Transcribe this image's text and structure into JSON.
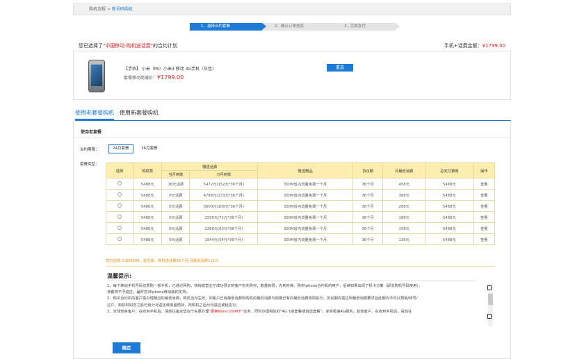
{
  "breadcrumb": {
    "root": "购机流程",
    "sep": ">",
    "current": "新号码购机"
  },
  "steps": [
    "1、选择合约套餐",
    "2、确认订单信息",
    "3、完成支付"
  ],
  "plan_line": {
    "prefix": "您已选择了",
    "quote_open": "\"",
    "plan_name": "中国移动-购机送话费",
    "quote_close": "\"",
    "suffix": "的合约计划"
  },
  "total": {
    "label": "手机+话费金额：",
    "amount": "¥1799.00"
  },
  "product": {
    "name": "【手机】 小米（MI）小米3 移动 3G手机（灰色）",
    "price_label": "套餐移动商城价：",
    "price": "¥1799.00",
    "reselect_label": "重选"
  },
  "tabs": {
    "active": "使用老套餐购机",
    "inactive": "使用新套餐购机"
  },
  "panel": {
    "title": "使用老套餐",
    "term_label": "合约期限：",
    "term_options": [
      "24月套餐",
      "36月套餐"
    ],
    "type_label": "套餐类型："
  },
  "table": {
    "headers": {
      "select": "选择",
      "deposit": "购机款",
      "gift": "赠送话费",
      "gift_now": "当月到账",
      "gift_monthly": "分月到账",
      "gift_item": "赠送赠品",
      "term": "协议期",
      "min_spend": "月最低消费",
      "total_pay": "总支付费用",
      "action": "操作"
    },
    "rows": [
      {
        "deposit": "5488元",
        "now": "16元话费",
        "monthly": "5472元(152元*36个月)",
        "gift": "300M省内流量免费一个月",
        "term": "36个月",
        "min": "458元",
        "total": "5488元",
        "action": "查看"
      },
      {
        "deposit": "5488元",
        "now": "0元话费",
        "monthly": "4788元(133元*36个月)",
        "gift": "300M省内流量免费一个月",
        "term": "36个月",
        "min": "368元",
        "total": "5488元",
        "action": "查看"
      },
      {
        "deposit": "5488元",
        "now": "0元话费",
        "monthly": "3600元(100元*36个月)",
        "gift": "300M省内流量免费一个月",
        "term": "36个月",
        "min": "268元",
        "total": "5488元",
        "action": "查看"
      },
      {
        "deposit": "5488元",
        "now": "0元话费",
        "monthly": "2556元(71元*36个月)",
        "gift": "300M省内流量免费一个月",
        "term": "36个月",
        "min": "188元",
        "total": "5488元",
        "action": "查看"
      },
      {
        "deposit": "5488元",
        "now": "0元话费",
        "monthly": "2268元(63元*36个月)",
        "gift": "300M省内流量免费一个月",
        "term": "36个月",
        "min": "158元",
        "total": "5488元",
        "action": "查看"
      },
      {
        "deposit": "5488元",
        "now": "0元话费",
        "monthly": "1944元(54元*36个月)",
        "gift": "300M省内流量免费一个月",
        "term": "36个月",
        "min": "138元",
        "total": "5488元",
        "action": "查看"
      }
    ]
  },
  "summary": "您已选择:三星i9508，星空黑，购机送话费36个月,月最低消费111元",
  "tips": {
    "title": "温馨提示:",
    "line1": "1、每个移动手机号码仅限购一部手机，已通过网购、热线或营业厅成功预订的客户优先购买，数量有限，先到先得。购买Iphone合约机的用户，后续如果出现了机卡分离（即非购机号码使用），",
    "line2": "该套将不予返还，届时您对Iphone移动版的支持。",
    "line3": "2、购买合约机的客户需办理相应的最低消费，购机当月生效，如客户已有最低消费则购机的最低消费与前期已有的最低消费规则执行，协议期内需达到最低消费要求且此期内不可以预销/转号/",
    "line4": "过户。购机时如您之前已有分月返还或保留预存，则购机之后分月返还或延执行。",
    "line5_pre": "3、全球知英客户，在收到手机后，请前往指定营业厅先更办理",
    "line5_red": "\"更换Nano USIM卡\"",
    "line5_post": "业务，同时办理相应的\"4G飞享套餐或自选套餐\"，享受极速4G服务。其他客户，在收到手机后，请前往"
  },
  "confirm_label": "确定"
}
